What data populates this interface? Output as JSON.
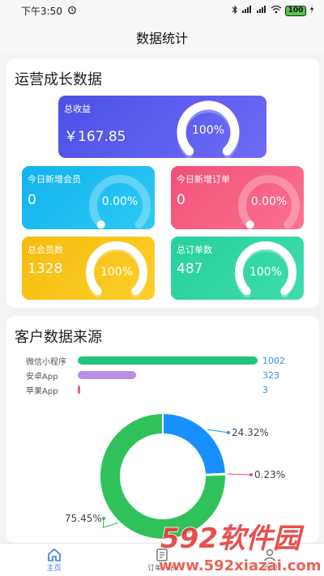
{
  "status": {
    "time": "下午3:50",
    "battery": "100"
  },
  "header": {
    "title": "数据统计"
  },
  "growth": {
    "title": "运营成长数据",
    "total_revenue": {
      "label": "总收益",
      "value": "￥167.85",
      "percent": "100%",
      "fraction": 1.0,
      "color": "#5a5df0"
    },
    "new_members": {
      "label": "今日新增会员",
      "value": "0",
      "percent": "0.00%",
      "fraction": 0.0,
      "color": "#1ebcf0"
    },
    "new_orders": {
      "label": "今日新增订单",
      "value": "0",
      "percent": "0.00%",
      "fraction": 0.0,
      "color": "#f55f7e"
    },
    "total_members": {
      "label": "总会员数",
      "value": "1328",
      "percent": "100%",
      "fraction": 1.0,
      "color": "#f7c416"
    },
    "total_orders": {
      "label": "总订单数",
      "value": "487",
      "percent": "100%",
      "fraction": 1.0,
      "color": "#2fd3a3"
    }
  },
  "sources": {
    "title": "客户数据来源",
    "bars": [
      {
        "label": "微信小程序",
        "value": "1002",
        "count": 1002,
        "color": "#21c47a"
      },
      {
        "label": "安卓App",
        "value": "323",
        "count": 323,
        "color": "#b98ee8"
      },
      {
        "label": "苹果App",
        "value": "3",
        "count": 3,
        "color": "#e4657d"
      }
    ]
  },
  "chart_data": {
    "type": "pie",
    "categories": [
      "微信小程序",
      "安卓App",
      "苹果App"
    ],
    "values": [
      75.45,
      24.32,
      0.23
    ],
    "labels": [
      "75.45%",
      "24.32%",
      "0.23%"
    ],
    "colors": [
      "#2fc25b",
      "#1890ff",
      "#f04864"
    ]
  },
  "tabs": [
    {
      "label": "主页",
      "icon": "home-icon",
      "active": true
    },
    {
      "label": "订单列表",
      "icon": "order-list-icon",
      "active": false
    },
    {
      "label": "我的",
      "icon": "user-icon",
      "active": false
    }
  ],
  "watermark": {
    "brand": "592软件园",
    "url": "www.592xiazai.com"
  }
}
